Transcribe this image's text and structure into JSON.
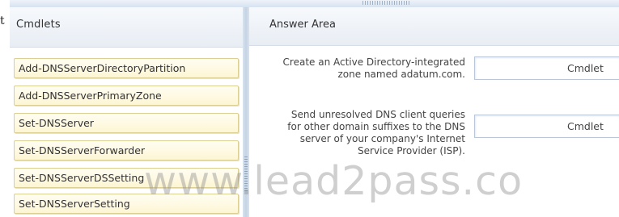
{
  "stray_char": "t",
  "cmdlets": {
    "title": "Cmdlets",
    "items": [
      {
        "label": "Add-DNSServerDirectoryPartition"
      },
      {
        "label": "Add-DNSServerPrimaryZone"
      },
      {
        "label": "Set-DNSServer"
      },
      {
        "label": "Set-DNSServerForwarder"
      },
      {
        "label": "Set-DNSServerDSSetting"
      },
      {
        "label": "Set-DNSServerSetting"
      }
    ]
  },
  "answer_area": {
    "title": "Answer Area",
    "questions": [
      {
        "lines": [
          "Create an Active Directory-integrated",
          "zone named adatum.com."
        ],
        "target": "Cmdlet"
      },
      {
        "lines": [
          "Send unresolved DNS client queries",
          "for other domain suffixes to the DNS",
          "server of your company's Internet",
          "Service Provider (ISP)."
        ],
        "target": "Cmdlet"
      }
    ]
  },
  "watermark": "www.lead2pass.co"
}
